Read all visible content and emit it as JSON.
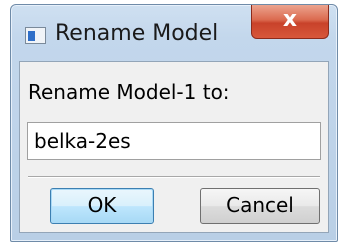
{
  "window": {
    "title": "Rename Model",
    "app_icon": "window-app-icon",
    "close_label": "x"
  },
  "dialog": {
    "prompt": "Rename Model-1 to:",
    "name_value": "belka-2es",
    "ok_label": "OK",
    "cancel_label": "Cancel"
  },
  "colors": {
    "close_button": "#c8422a",
    "default_button_border": "#3c7fb1",
    "frame": "#b9cfe6",
    "client": "#f0f0f0"
  }
}
